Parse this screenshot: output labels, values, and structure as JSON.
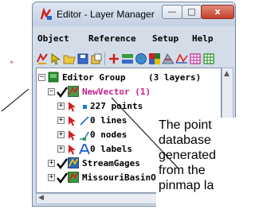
{
  "window": {
    "title": "Editor - Layer Manager",
    "buttons": {
      "minimize": "—",
      "maximize": "□",
      "close": "x"
    }
  },
  "menu": [
    "Object",
    "Reference",
    "Setup",
    "Help"
  ],
  "tree": {
    "group": {
      "label": "Editor Group",
      "count": "(3 layers)"
    },
    "layer": {
      "label": "NewVector (1)"
    },
    "elements": [
      {
        "label": "227 points"
      },
      {
        "label": "0 lines"
      },
      {
        "label": "0 nodes"
      },
      {
        "label": "0 labels"
      }
    ],
    "other_layers": [
      {
        "label": "StreamGages"
      },
      {
        "label": "MissouriBasinOut"
      }
    ]
  },
  "callout": {
    "lines": [
      "The point",
      "database",
      "generated",
      "from the",
      "pinmap la"
    ]
  },
  "colors": {
    "title_bar": "#c3d0e2",
    "close_button": "#c3402a",
    "active_layer_text": "#c81e8c",
    "leader_line": "#d94a8a"
  }
}
